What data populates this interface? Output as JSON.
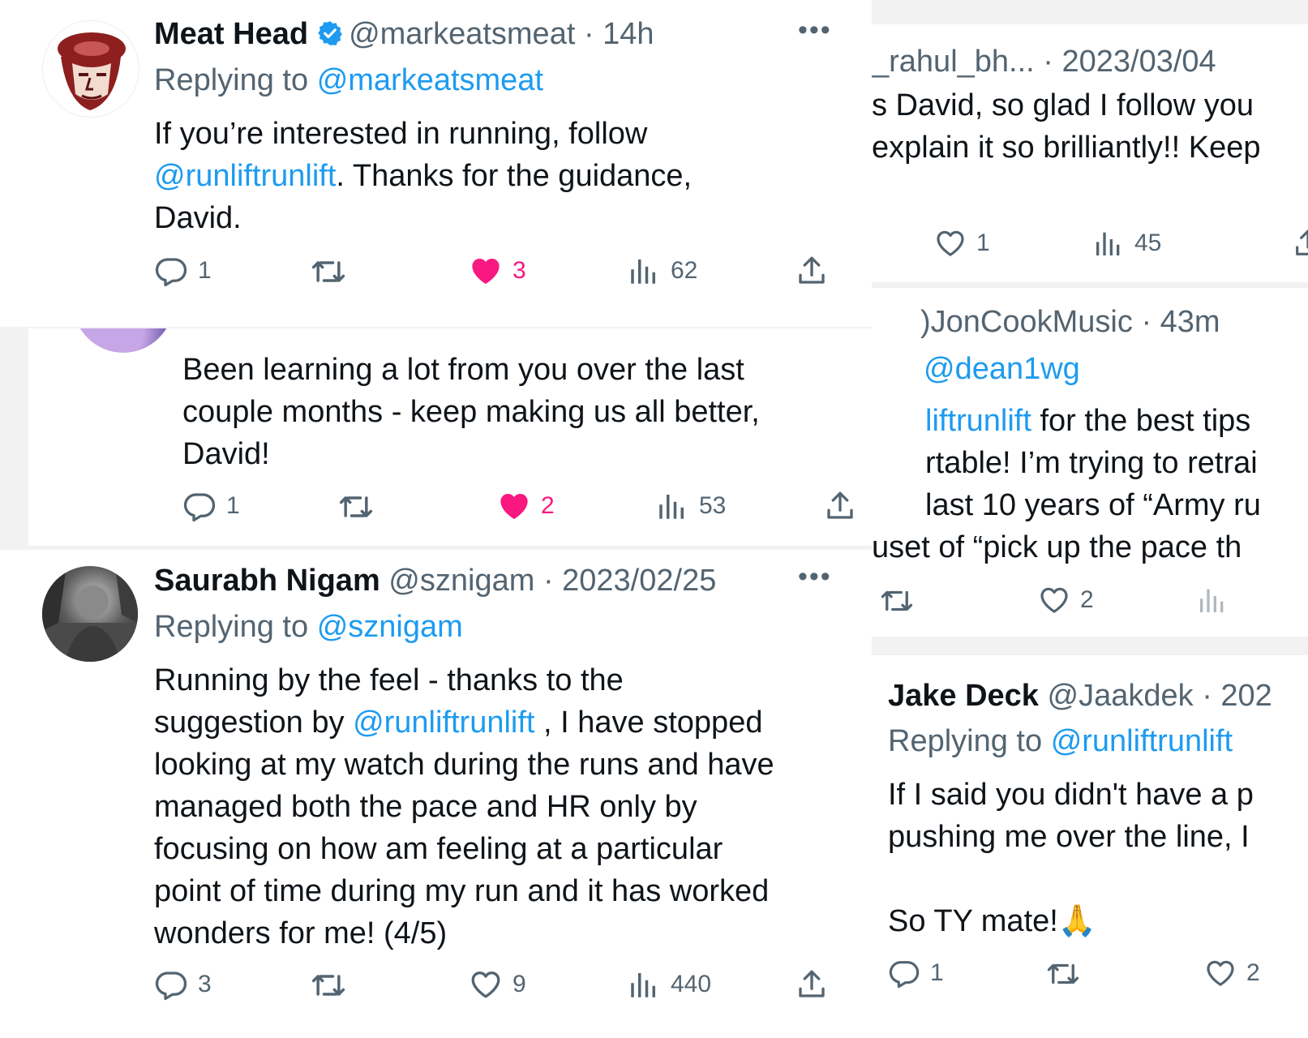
{
  "colors": {
    "link": "#1d9bf0",
    "like_active": "#f91880",
    "meta": "#536471",
    "verified": "#1d9bf0"
  },
  "tweet1": {
    "name": "Meat Head",
    "handle": "@markeatsmeat",
    "time": "· 14h",
    "replying_label": "Replying to",
    "replying_to": "@markeatsmeat",
    "text_a": "If you’re interested in running, follow",
    "mention": "@runliftrunlift",
    "text_b": ". Thanks for the guidance,",
    "text_c": "David.",
    "replies": "1",
    "likes": "3",
    "views": "62",
    "icons": {
      "avatar": "meat-head-avatar",
      "verified": "verified-badge-icon"
    }
  },
  "tweet2": {
    "line1": "Been learning a lot from you over the last",
    "line2": "couple months - keep making us all better,",
    "line3": "David!",
    "replies": "1",
    "likes": "2",
    "views": "53"
  },
  "tweet3": {
    "name": "Saurabh Nigam",
    "handle": "@sznigam",
    "time": "· 2023/02/25",
    "replying_label": "Replying to",
    "replying_to": "@sznigam",
    "line1": "Running by the feel - thanks to the",
    "line2a": "suggestion by",
    "mention": "@runliftrunlift",
    "line2b": ", I have stopped",
    "line3": "looking at my watch during the runs and have",
    "line4": "managed both the pace and HR only by",
    "line5": "focusing on how am feeling at a particular",
    "line6": "point of time during my run and it has worked",
    "line7": "wonders for me! (4/5)",
    "replies": "3",
    "likes": "9",
    "views": "440"
  },
  "right1": {
    "handle": "_rahul_bh...",
    "time": "· 2023/03/04",
    "line1": "s David, so glad I follow you",
    "line2": "explain it so brilliantly!! Keep",
    "likes": "1",
    "views": "45"
  },
  "right2": {
    "handle": ")JonCookMusic",
    "time": "· 43m",
    "replying_to": "@dean1wg",
    "mention": "liftrunlift",
    "line1_rest": " for the best tips",
    "line2": "rtable! I’m trying to retrai",
    "line3": "last 10 years of “Army ru",
    "line4": "uset of “pick up the pace th",
    "likes": "2"
  },
  "right3": {
    "name": "Jake Deck",
    "handle": "@Jaakdek",
    "time": "· 202",
    "replying_label": "Replying to",
    "replying_to": "@runliftrunlift",
    "line1": "If I said you didn't have a p",
    "line2": "pushing me over the line, I",
    "line3": "So TY mate!🙏",
    "replies": "1",
    "likes": "2"
  }
}
